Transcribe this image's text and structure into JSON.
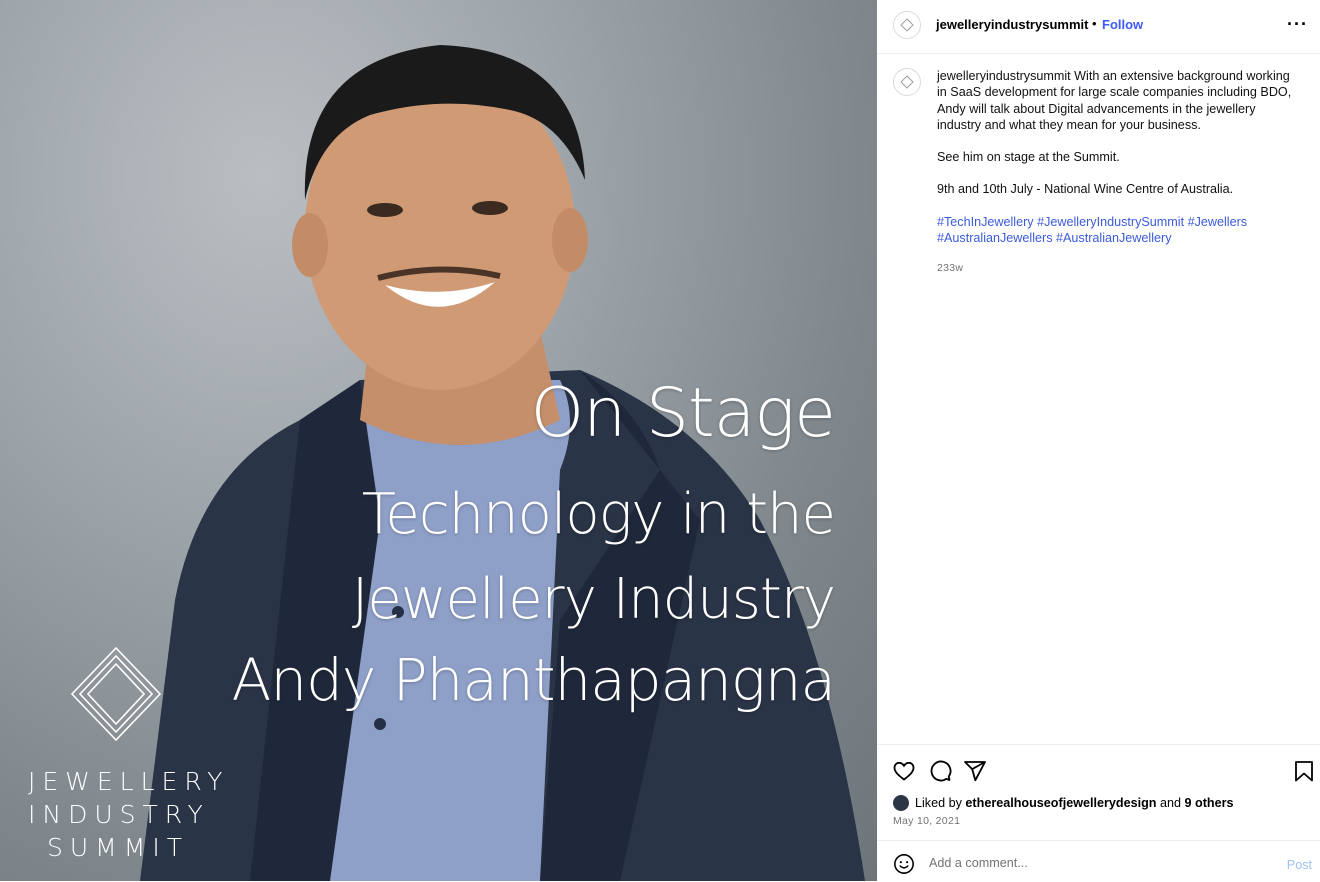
{
  "image": {
    "overlay_line1": "On Stage",
    "overlay_line2": "Technology in the Jewellery Industry",
    "overlay_line3": "Andy Phanthapangna",
    "logo_line1": "JEWELLERY",
    "logo_line2": "INDUSTRY",
    "logo_line3": "SUMMIT"
  },
  "header": {
    "username": "jewelleryindustrysummit",
    "separator": "•",
    "follow_label": "Follow",
    "more_label": "···"
  },
  "caption": {
    "username": "jewelleryindustrysummit",
    "text": "With an extensive background working in SaaS development for large scale companies including BDO, Andy will talk about Digital advancements in the jewellery industry and what they mean for your business.",
    "para2": "See him on stage at the Summit.",
    "para3": "9th and 10th July - National Wine Centre of Australia.",
    "hashtags": [
      "#TechInJewellery",
      "#JewelleryIndustrySummit",
      "#Jewellers",
      "#AustralianJewellers",
      "#AustralianJewellery"
    ],
    "age": "233w"
  },
  "actions": {
    "icons": [
      "heart-icon",
      "comment-icon",
      "share-icon",
      "bookmark-icon"
    ],
    "liked_by_prefix": "Liked by",
    "liked_by_user": "etherealhouseofjewellerydesign",
    "liked_by_and": "and",
    "liked_by_others": "9 others",
    "date": "May 10, 2021"
  },
  "comment": {
    "placeholder": "Add a comment...",
    "post_label": "Post"
  },
  "colors": {
    "link": "#3b5bdb",
    "follow": "#3d5afe",
    "muted": "#737373",
    "post_disabled": "#9fc2f7"
  }
}
